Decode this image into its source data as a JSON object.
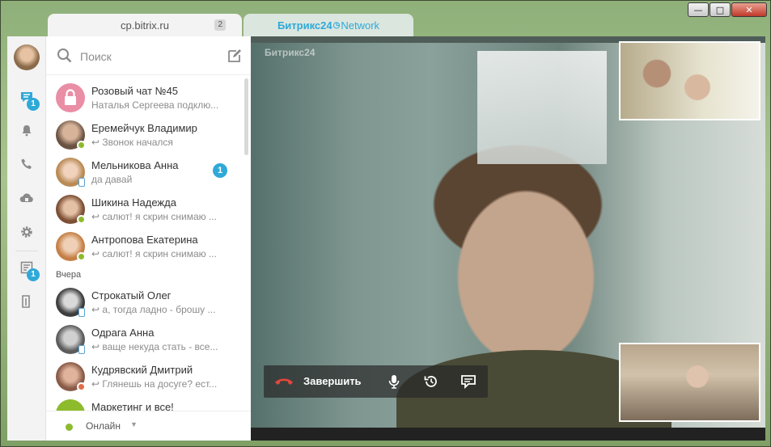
{
  "window": {
    "controls": [
      "minimize",
      "maximize",
      "close"
    ]
  },
  "tabs": [
    {
      "label": "cp.bitrix.ru",
      "badge": "2",
      "active": true
    },
    {
      "label_brand": "Битрикс24",
      "label_net": "Network",
      "active": false
    }
  ],
  "rail": {
    "chat_badge": "1",
    "notify_badge": "1"
  },
  "search": {
    "placeholder": "Поиск"
  },
  "chats": [
    {
      "name": "Розовый чат №45",
      "sub": "Наталья Сергеева подклю...",
      "status": "none",
      "avatar": "lock",
      "avatar_color": "#e98ea5"
    },
    {
      "name": "Еремейчук Владимир",
      "sub": "Звонок начался",
      "reply": true,
      "status": "online",
      "avatar_color": "#9c7b64"
    },
    {
      "name": "Мельникова Анна",
      "sub": "да давай",
      "status": "mobile",
      "avatar_color": "#c9a58b",
      "count": "1"
    },
    {
      "name": "Шикина Надежда",
      "sub": "салют! я скрин снимаю ...",
      "reply": true,
      "status": "online",
      "avatar_color": "#a06b4c"
    },
    {
      "name": "Антропова Екатерина",
      "sub": "салют! я скрин снимаю ...",
      "reply": true,
      "status": "online",
      "avatar_color": "#c58f63"
    },
    {
      "name": "Строкатый Олег",
      "sub": "а, тогда ладно - брошу ...",
      "reply": true,
      "status": "mobile",
      "avatar_color": "#6d6d6d"
    },
    {
      "name": "Одрага Анна",
      "sub": "ваще некуда стать - все...",
      "reply": true,
      "status": "mobile",
      "avatar_color": "#7a6a5e"
    },
    {
      "name": "Кудрявский Дмитрий",
      "sub": "Глянешь на досуге? ест...",
      "reply": true,
      "status": "dnd",
      "avatar_color": "#b57f67"
    },
    {
      "name": "Маркетинг и все!",
      "sub": "",
      "status": "none",
      "avatar_color": "#8dbb2c"
    }
  ],
  "section_yesterday": "Вчера",
  "footer": {
    "status_label": "Онлайн"
  },
  "video": {
    "brand": "Битрикс24",
    "hangup_label": "Завершить"
  },
  "colors": {
    "accent": "#2fa9d8",
    "online": "#8dbb2c",
    "hangup": "#e0473b"
  }
}
